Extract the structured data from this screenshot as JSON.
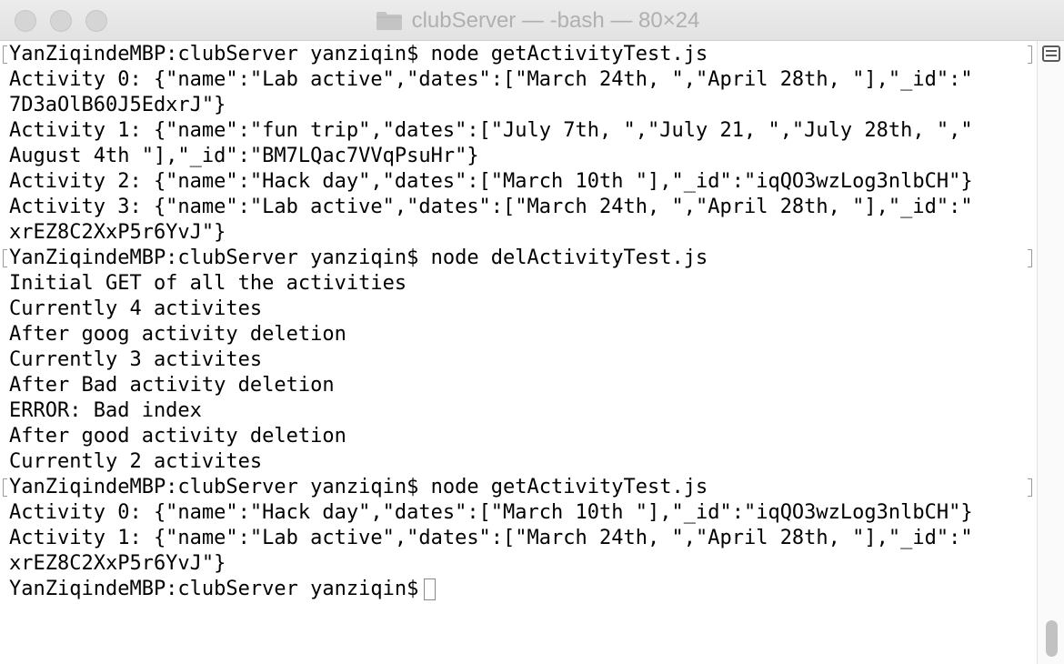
{
  "window": {
    "title": "clubServer — -bash — 80×24"
  },
  "terminal": {
    "lines": [
      {
        "text": "YanZiqindeMBP:clubServer yanziqin$ node getActivityTest.js",
        "marked": true
      },
      {
        "text": "Activity 0: {\"name\":\"Lab active\",\"dates\":[\"March 24th, \",\"April 28th, \"],\"_id\":\"",
        "marked": false
      },
      {
        "text": "7D3aOlB60J5EdxrJ\"}",
        "marked": false
      },
      {
        "text": "Activity 1: {\"name\":\"fun trip\",\"dates\":[\"July 7th, \",\"July 21, \",\"July 28th, \",\"",
        "marked": false
      },
      {
        "text": "August 4th \"],\"_id\":\"BM7LQac7VVqPsuHr\"}",
        "marked": false
      },
      {
        "text": "Activity 2: {\"name\":\"Hack day\",\"dates\":[\"March 10th \"],\"_id\":\"iqQO3wzLog3nlbCH\"}",
        "marked": false
      },
      {
        "text": "Activity 3: {\"name\":\"Lab active\",\"dates\":[\"March 24th, \",\"April 28th, \"],\"_id\":\"",
        "marked": false
      },
      {
        "text": "xrEZ8C2XxP5r6YvJ\"}",
        "marked": false
      },
      {
        "text": "YanZiqindeMBP:clubServer yanziqin$ node delActivityTest.js",
        "marked": true
      },
      {
        "text": "Initial GET of all the activities",
        "marked": false
      },
      {
        "text": "Currently 4 activites",
        "marked": false
      },
      {
        "text": "After goog activity deletion",
        "marked": false
      },
      {
        "text": "Currently 3 activites",
        "marked": false
      },
      {
        "text": "After Bad activity deletion",
        "marked": false
      },
      {
        "text": "ERROR: Bad index",
        "marked": false
      },
      {
        "text": "After good activity deletion",
        "marked": false
      },
      {
        "text": "Currently 2 activites",
        "marked": false
      },
      {
        "text": "YanZiqindeMBP:clubServer yanziqin$ node getActivityTest.js",
        "marked": true
      },
      {
        "text": "Activity 0: {\"name\":\"Hack day\",\"dates\":[\"March 10th \"],\"_id\":\"iqQO3wzLog3nlbCH\"}",
        "marked": false
      },
      {
        "text": "Activity 1: {\"name\":\"Lab active\",\"dates\":[\"March 24th, \",\"April 28th, \"],\"_id\":\"",
        "marked": false
      },
      {
        "text": "xrEZ8C2XxP5r6YvJ\"}",
        "marked": false
      }
    ],
    "prompt": "YanZiqindeMBP:clubServer yanziqin$"
  }
}
